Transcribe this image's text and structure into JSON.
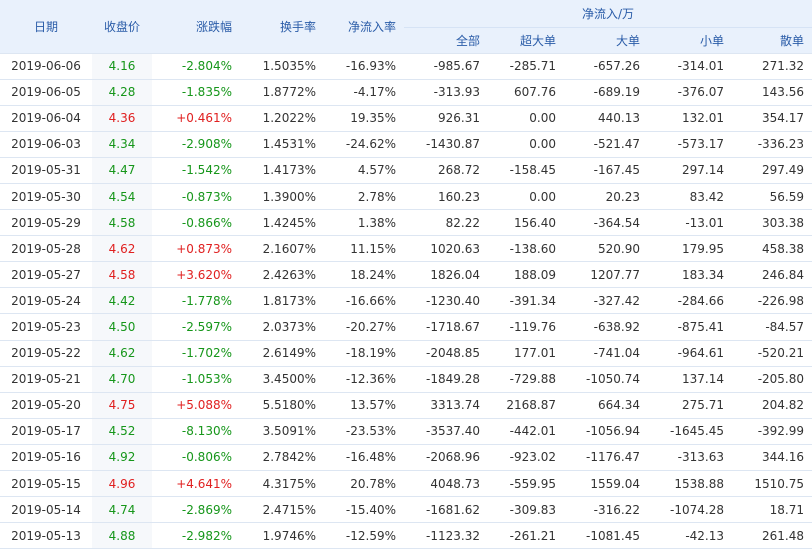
{
  "header": {
    "date": "日期",
    "price": "收盘价",
    "change": "涨跌幅",
    "turnover": "换手率",
    "net_ratio": "净流入率",
    "group": "净流入/万",
    "all": "全部",
    "xl": "超大单",
    "large": "大单",
    "small": "小单",
    "retail": "散单"
  },
  "colors": {
    "up": "#e02020",
    "down": "#16961a",
    "header_bg": "#e9f1fc",
    "header_text": "#2a5ca8"
  },
  "icons": {
    "sort": "arrow-down-icon"
  },
  "rows": [
    {
      "date": "2019-06-06",
      "price": "4.16",
      "change": "-2.804%",
      "turnover": "1.5035%",
      "net_ratio": "-16.93%",
      "all": "-985.67",
      "xl": "-285.71",
      "large": "-657.26",
      "small": "-314.01",
      "retail": "271.32",
      "dir": "down"
    },
    {
      "date": "2019-06-05",
      "price": "4.28",
      "change": "-1.835%",
      "turnover": "1.8772%",
      "net_ratio": "-4.17%",
      "all": "-313.93",
      "xl": "607.76",
      "large": "-689.19",
      "small": "-376.07",
      "retail": "143.56",
      "dir": "down"
    },
    {
      "date": "2019-06-04",
      "price": "4.36",
      "change": "+0.461%",
      "turnover": "1.2022%",
      "net_ratio": "19.35%",
      "all": "926.31",
      "xl": "0.00",
      "large": "440.13",
      "small": "132.01",
      "retail": "354.17",
      "dir": "up"
    },
    {
      "date": "2019-06-03",
      "price": "4.34",
      "change": "-2.908%",
      "turnover": "1.4531%",
      "net_ratio": "-24.62%",
      "all": "-1430.87",
      "xl": "0.00",
      "large": "-521.47",
      "small": "-573.17",
      "retail": "-336.23",
      "dir": "down"
    },
    {
      "date": "2019-05-31",
      "price": "4.47",
      "change": "-1.542%",
      "turnover": "1.4173%",
      "net_ratio": "4.57%",
      "all": "268.72",
      "xl": "-158.45",
      "large": "-167.45",
      "small": "297.14",
      "retail": "297.49",
      "dir": "down"
    },
    {
      "date": "2019-05-30",
      "price": "4.54",
      "change": "-0.873%",
      "turnover": "1.3900%",
      "net_ratio": "2.78%",
      "all": "160.23",
      "xl": "0.00",
      "large": "20.23",
      "small": "83.42",
      "retail": "56.59",
      "dir": "down"
    },
    {
      "date": "2019-05-29",
      "price": "4.58",
      "change": "-0.866%",
      "turnover": "1.4245%",
      "net_ratio": "1.38%",
      "all": "82.22",
      "xl": "156.40",
      "large": "-364.54",
      "small": "-13.01",
      "retail": "303.38",
      "dir": "down"
    },
    {
      "date": "2019-05-28",
      "price": "4.62",
      "change": "+0.873%",
      "turnover": "2.1607%",
      "net_ratio": "11.15%",
      "all": "1020.63",
      "xl": "-138.60",
      "large": "520.90",
      "small": "179.95",
      "retail": "458.38",
      "dir": "up"
    },
    {
      "date": "2019-05-27",
      "price": "4.58",
      "change": "+3.620%",
      "turnover": "2.4263%",
      "net_ratio": "18.24%",
      "all": "1826.04",
      "xl": "188.09",
      "large": "1207.77",
      "small": "183.34",
      "retail": "246.84",
      "dir": "up"
    },
    {
      "date": "2019-05-24",
      "price": "4.42",
      "change": "-1.778%",
      "turnover": "1.8173%",
      "net_ratio": "-16.66%",
      "all": "-1230.40",
      "xl": "-391.34",
      "large": "-327.42",
      "small": "-284.66",
      "retail": "-226.98",
      "dir": "down"
    },
    {
      "date": "2019-05-23",
      "price": "4.50",
      "change": "-2.597%",
      "turnover": "2.0373%",
      "net_ratio": "-20.27%",
      "all": "-1718.67",
      "xl": "-119.76",
      "large": "-638.92",
      "small": "-875.41",
      "retail": "-84.57",
      "dir": "down"
    },
    {
      "date": "2019-05-22",
      "price": "4.62",
      "change": "-1.702%",
      "turnover": "2.6149%",
      "net_ratio": "-18.19%",
      "all": "-2048.85",
      "xl": "177.01",
      "large": "-741.04",
      "small": "-964.61",
      "retail": "-520.21",
      "dir": "down"
    },
    {
      "date": "2019-05-21",
      "price": "4.70",
      "change": "-1.053%",
      "turnover": "3.4500%",
      "net_ratio": "-12.36%",
      "all": "-1849.28",
      "xl": "-729.88",
      "large": "-1050.74",
      "small": "137.14",
      "retail": "-205.80",
      "dir": "down"
    },
    {
      "date": "2019-05-20",
      "price": "4.75",
      "change": "+5.088%",
      "turnover": "5.5180%",
      "net_ratio": "13.57%",
      "all": "3313.74",
      "xl": "2168.87",
      "large": "664.34",
      "small": "275.71",
      "retail": "204.82",
      "dir": "up"
    },
    {
      "date": "2019-05-17",
      "price": "4.52",
      "change": "-8.130%",
      "turnover": "3.5091%",
      "net_ratio": "-23.53%",
      "all": "-3537.40",
      "xl": "-442.01",
      "large": "-1056.94",
      "small": "-1645.45",
      "retail": "-392.99",
      "dir": "down"
    },
    {
      "date": "2019-05-16",
      "price": "4.92",
      "change": "-0.806%",
      "turnover": "2.7842%",
      "net_ratio": "-16.48%",
      "all": "-2068.96",
      "xl": "-923.02",
      "large": "-1176.47",
      "small": "-313.63",
      "retail": "344.16",
      "dir": "down"
    },
    {
      "date": "2019-05-15",
      "price": "4.96",
      "change": "+4.641%",
      "turnover": "4.3175%",
      "net_ratio": "20.78%",
      "all": "4048.73",
      "xl": "-559.95",
      "large": "1559.04",
      "small": "1538.88",
      "retail": "1510.75",
      "dir": "up"
    },
    {
      "date": "2019-05-14",
      "price": "4.74",
      "change": "-2.869%",
      "turnover": "2.4715%",
      "net_ratio": "-15.40%",
      "all": "-1681.62",
      "xl": "-309.83",
      "large": "-316.22",
      "small": "-1074.28",
      "retail": "18.71",
      "dir": "down"
    },
    {
      "date": "2019-05-13",
      "price": "4.88",
      "change": "-2.982%",
      "turnover": "1.9746%",
      "net_ratio": "-12.59%",
      "all": "-1123.32",
      "xl": "-261.21",
      "large": "-1081.45",
      "small": "-42.13",
      "retail": "261.48",
      "dir": "down"
    }
  ]
}
